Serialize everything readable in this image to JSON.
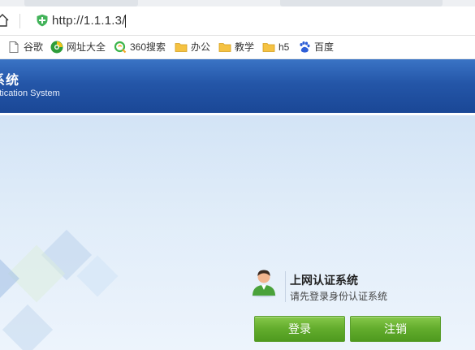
{
  "browser": {
    "url": "http://1.1.1.3/",
    "bookmarks": [
      {
        "label": "谷歌",
        "icon": "page-icon"
      },
      {
        "label": "网址大全",
        "icon": "site-nav-icon"
      },
      {
        "label": "360搜索",
        "icon": "360-search-icon"
      },
      {
        "label": "办公",
        "icon": "folder-icon"
      },
      {
        "label": "教学",
        "icon": "folder-icon"
      },
      {
        "label": "h5",
        "icon": "folder-icon"
      },
      {
        "label": "百度",
        "icon": "baidu-paw-icon"
      }
    ]
  },
  "header": {
    "title": "系统",
    "subtitle": "entication System"
  },
  "login": {
    "title": "上网认证系统",
    "subtitle": "请先登录身份认证系统",
    "login_label": "登录",
    "logout_label": "注销"
  },
  "colors": {
    "header_blue": "#2456a8",
    "button_green": "#62ac2c",
    "body_bg": "#e1edf9"
  }
}
